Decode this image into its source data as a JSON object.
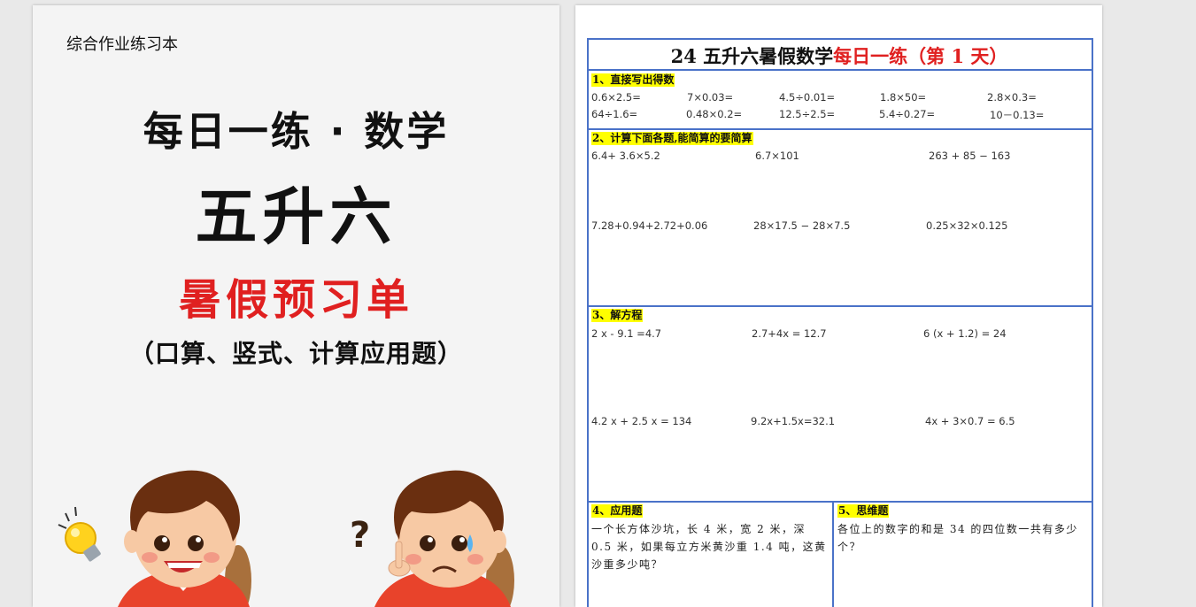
{
  "cover": {
    "tag": "综合作业练习本",
    "title1": "每日一练 · 数学",
    "title2": "五升六",
    "title3": "暑假预习单",
    "title4": "（口算、竖式、计算应用题）",
    "question_mark": "?",
    "illustration": [
      "lightbulb-icon",
      "happy-boy",
      "thinking-boy"
    ]
  },
  "sheet": {
    "title_prefix": "24 五升六暑假数学",
    "title_red": "每日一练（第 1 天）",
    "section1": {
      "label": "1、直接写出得数",
      "items": [
        "0.6×2.5=",
        "7×0.03=",
        "4.5÷0.01=",
        "1.8×50=",
        "2.8×0.3=",
        "64÷1.6=",
        "0.48×0.2=",
        "12.5÷2.5=",
        "5.4÷0.27=",
        "10－0.13="
      ]
    },
    "section2": {
      "label": "2、计算下面各题,能简算的要简算",
      "items": [
        "6.4+ 3.6×5.2",
        "6.7×101",
        "263 + 85 − 163",
        "7.28+0.94+2.72+0.06",
        "28×17.5 − 28×7.5",
        "0.25×32×0.125"
      ]
    },
    "section3": {
      "label": "3、解方程",
      "items": [
        "2 x  -  9.1 =4.7",
        "2.7+4x = 12.7",
        "6 (x + 1.2) = 24",
        "4.2 x + 2.5 x = 134",
        "9.2x+1.5x=32.1",
        "4x + 3×0.7 = 6.5"
      ]
    },
    "section4": {
      "label": "4、应用题",
      "text": "一个长方体沙坑，长 4 米，宽 2 米，深 0.5 米，如果每立方米黄沙重 1.4 吨，这黄沙重多少吨？"
    },
    "section5": {
      "label": "5、思维题",
      "text": "各位上的数字的和是 34 的四位数一共有多少个？"
    }
  },
  "colors": {
    "accent_red": "#e02020",
    "table_border": "#4a72c8",
    "highlight": "#ffff00"
  }
}
